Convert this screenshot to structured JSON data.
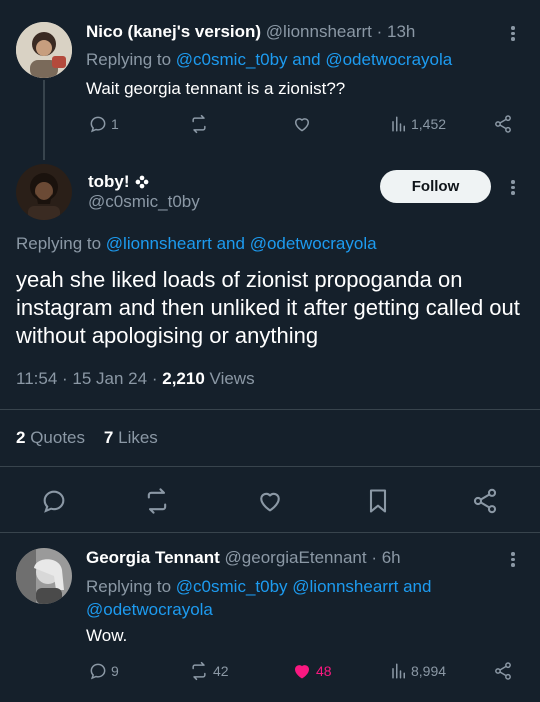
{
  "tweet1": {
    "name": "Nico (kanej's version)",
    "handle": "@lionnshearrt",
    "sep": "·",
    "time": "13h",
    "replying_prefix": "Replying to",
    "replying_users": "@c0smic_t0by and @odetwocrayola",
    "text": "Wait georgia tennant is a zionist??",
    "replies": "1",
    "views": "1,452"
  },
  "tweet2": {
    "name": "toby!",
    "handle": "@c0smic_t0by",
    "follow_label": "Follow",
    "replying_prefix": "Replying to",
    "replying_users": "@lionnshearrt and @odetwocrayola",
    "text": "yeah she liked loads of zionist propoganda on instagram and then unliked it after getting called out without apologising or anything",
    "time": "11:54",
    "date": "15 Jan 24",
    "sep": "·",
    "views_count": "2,210",
    "views_label": "Views",
    "quotes_count": "2",
    "quotes_label": "Quotes",
    "likes_count": "7",
    "likes_label": "Likes"
  },
  "tweet3": {
    "name": "Georgia Tennant",
    "handle": "@georgiaEtennant",
    "sep": "·",
    "time": "6h",
    "replying_prefix": "Replying to",
    "replying_users": "@c0smic_t0by @lionnshearrt and @odetwocrayola",
    "text": "Wow.",
    "replies": "9",
    "reposts": "42",
    "likes": "48",
    "views": "8,994"
  },
  "colors": {
    "background": "#15202b",
    "accent": "#1d9bf0",
    "muted": "#8b98a5",
    "like_active": "#f91880"
  }
}
